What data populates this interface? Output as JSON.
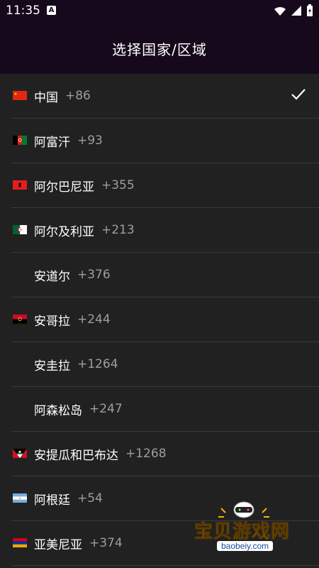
{
  "status_bar": {
    "time": "11:35",
    "notification_letter": "A"
  },
  "header": {
    "title": "选择国家/区域"
  },
  "countries": [
    {
      "name": "中国",
      "code": "+86",
      "selected": true,
      "flag": "cn"
    },
    {
      "name": "阿富汗",
      "code": "+93",
      "selected": false,
      "flag": "af"
    },
    {
      "name": "阿尔巴尼亚",
      "code": "+355",
      "selected": false,
      "flag": "al"
    },
    {
      "name": "阿尔及利亚",
      "code": "+213",
      "selected": false,
      "flag": "dz"
    },
    {
      "name": "安道尔",
      "code": "+376",
      "selected": false,
      "flag": ""
    },
    {
      "name": "安哥拉",
      "code": "+244",
      "selected": false,
      "flag": "ao"
    },
    {
      "name": "安圭拉",
      "code": "+1264",
      "selected": false,
      "flag": ""
    },
    {
      "name": "阿森松岛",
      "code": "+247",
      "selected": false,
      "flag": ""
    },
    {
      "name": "安提瓜和巴布达",
      "code": "+1268",
      "selected": false,
      "flag": "ag"
    },
    {
      "name": "阿根廷",
      "code": "+54",
      "selected": false,
      "flag": "ar"
    },
    {
      "name": "亚美尼亚",
      "code": "+374",
      "selected": false,
      "flag": "am"
    }
  ],
  "watermark": {
    "brand": "宝贝游戏网",
    "url": "baobeiy.com"
  },
  "colors": {
    "header_bg": "#15091b",
    "list_bg": "#212121",
    "code_gray": "#9e9e9e",
    "divider": "#3a3a3a"
  }
}
